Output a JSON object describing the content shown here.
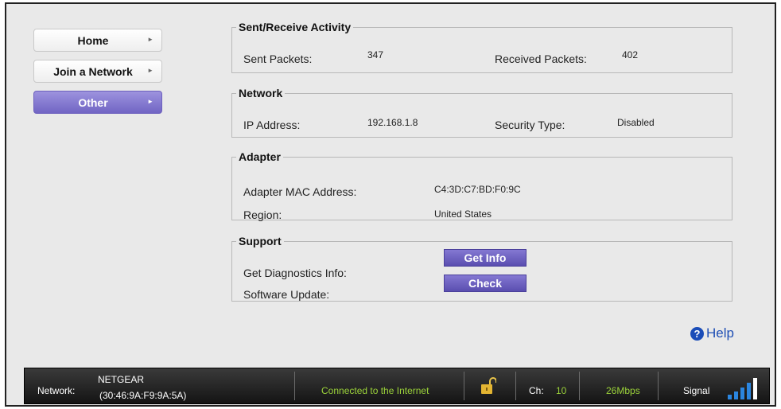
{
  "nav": {
    "home": "Home",
    "join": "Join a Network",
    "other": "Other",
    "arrow": "►"
  },
  "sent_receive": {
    "legend": "Sent/Receive Activity",
    "sent_label": "Sent Packets:",
    "sent_value": "347",
    "received_label": "Received Packets:",
    "received_value": "402"
  },
  "network": {
    "legend": "Network",
    "ip_label": "IP Address:",
    "ip_value": "192.168.1.8",
    "security_label": "Security Type:",
    "security_value": "Disabled"
  },
  "adapter": {
    "legend": "Adapter",
    "mac_label": "Adapter MAC Address:",
    "mac_value": "C4:3D:C7:BD:F0:9C",
    "region_label": "Region:",
    "region_value": "United States"
  },
  "support": {
    "legend": "Support",
    "diagnostics_label": "Get Diagnostics Info:",
    "diagnostics_button": "Get Info",
    "update_label": "Software Update:",
    "update_button": "Check"
  },
  "help": {
    "label": "Help",
    "icon": "?"
  },
  "status_bar": {
    "network_label": "Network:",
    "network_name": "NETGEAR",
    "network_mac": "(30:46:9A:F9:9A:5A)",
    "connection": "Connected to the Internet",
    "channel_label": "Ch:",
    "channel_value": "10",
    "speed": "26Mbps",
    "signal_label": "Signal",
    "signal_level": 1.0,
    "lock_icon": "unlocked-padlock-icon"
  },
  "colors": {
    "accent": "#7165c4",
    "status_green": "#9bd23a",
    "signal_blue": "#2b86e0"
  }
}
